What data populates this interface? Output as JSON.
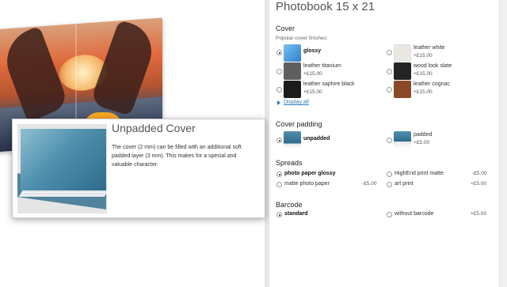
{
  "product_title": "Photobook 15 x 21",
  "cover": {
    "heading": "Cover",
    "subheading": "Popular cover finishes:",
    "options": [
      {
        "label": "glossy",
        "price": "",
        "selected": true,
        "swatch": "#3a8fd8"
      },
      {
        "label": "leather white",
        "price": "+£15.00",
        "selected": false,
        "swatch": "#e8e4df"
      },
      {
        "label": "leather titanium",
        "price": "+£15.00",
        "selected": false,
        "swatch": "#5d5d5d"
      },
      {
        "label": "wood look slate",
        "price": "+£15.00",
        "selected": false,
        "swatch": "#222222"
      },
      {
        "label": "leather saphire black",
        "price": "+£15.00",
        "selected": false,
        "swatch": "#1a1a1a"
      },
      {
        "label": "leather cognac",
        "price": "+£15.00",
        "selected": false,
        "swatch": "#8b4a25"
      }
    ],
    "display_all": "Display all"
  },
  "padding": {
    "heading": "Cover padding",
    "options": [
      {
        "label": "unpadded",
        "price": "",
        "selected": true
      },
      {
        "label": "padded",
        "price": "+£5.00",
        "selected": false
      }
    ]
  },
  "spreads": {
    "heading": "Spreads",
    "options": [
      {
        "label": "photo paper glossy",
        "price": "",
        "selected": true
      },
      {
        "label": "HighEnd print matte",
        "price": "-£5.00",
        "selected": false
      },
      {
        "label": "matte photo paper",
        "price": "-£5.00",
        "selected": false
      },
      {
        "label": "art print",
        "price": "+£5.00",
        "selected": false
      }
    ]
  },
  "barcode": {
    "heading": "Barcode",
    "options": [
      {
        "label": "standard",
        "price": "",
        "selected": true
      },
      {
        "label": "without barcode",
        "price": "+£5.00",
        "selected": false
      }
    ]
  },
  "tooltip": {
    "title": "Unpadded Cover",
    "text": "The cover (2 mm) can be filled with an additional soft padded layer (3 mm). This makes for a special and valuable character."
  }
}
